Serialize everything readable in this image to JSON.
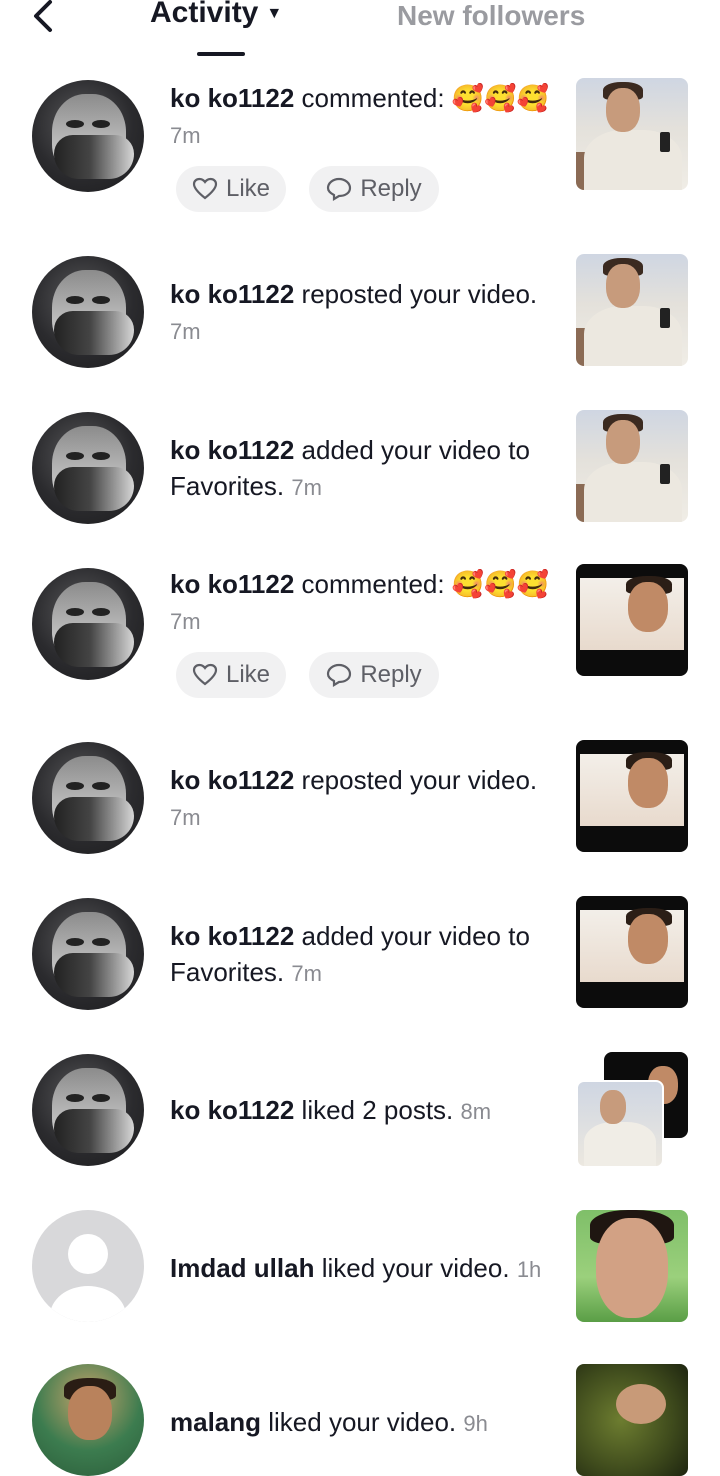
{
  "header": {
    "tab_activity": "Activity",
    "tab_new_followers": "New followers"
  },
  "buttons": {
    "like": "Like",
    "reply": "Reply"
  },
  "rows": [
    {
      "user": "ko ko1122",
      "action": " commented: 🥰🥰🥰",
      "time": "7m"
    },
    {
      "user": "ko ko1122",
      "action": " reposted your video.",
      "time": "7m"
    },
    {
      "user": "ko ko1122",
      "action": " added your video to Favorites.",
      "time": "7m"
    },
    {
      "user": "ko ko1122",
      "action": " commented: 🥰🥰🥰",
      "time": "7m"
    },
    {
      "user": "ko ko1122",
      "action": " reposted your video.",
      "time": "7m"
    },
    {
      "user": "ko ko1122",
      "action": " added your video to Favorites.",
      "time": "7m"
    },
    {
      "user": "ko ko1122",
      "action": " liked 2 posts.",
      "time": "8m"
    },
    {
      "user": "Imdad ullah",
      "action": " liked your video.",
      "time": "1h"
    },
    {
      "user": "malang",
      "action": " liked your video.",
      "time": "9h"
    }
  ]
}
